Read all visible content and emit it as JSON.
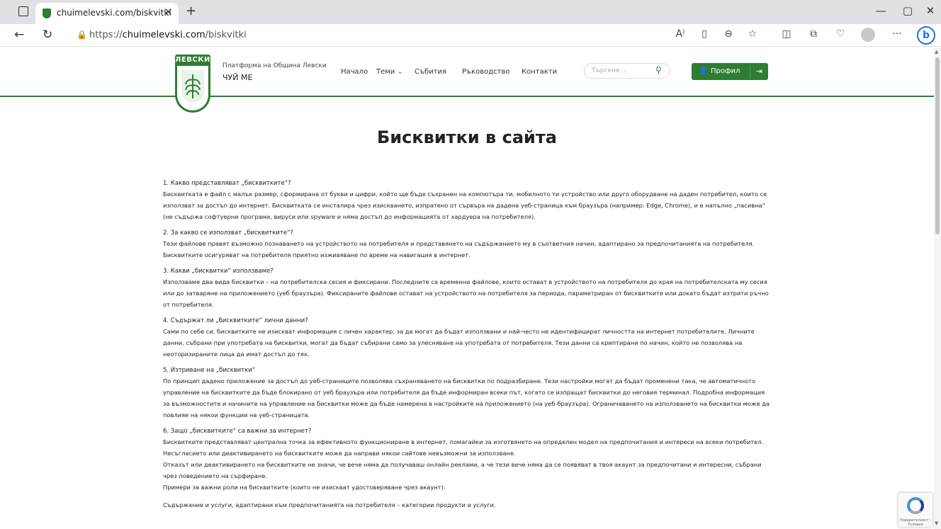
{
  "browser": {
    "tab_title": "chuimelevski.com/biskvitki",
    "tab_close": "×",
    "new_tab": "+",
    "url_prefix": "https://",
    "url_domain": "chuimelevski.com",
    "url_path": "/biskvitki",
    "window_controls": {
      "minimize": "—",
      "maximize": "▢",
      "close": "✕"
    },
    "nav": {
      "back": "←",
      "refresh": "↻"
    },
    "toolbar_icons": [
      "read-aloud-icon",
      "immersive-reader-icon",
      "zoom-icon",
      "favorite-icon",
      "split-screen-icon",
      "collections-icon",
      "browser-essentials-icon",
      "profile-icon",
      "more-icon",
      "bing-copilot-icon"
    ],
    "toolbar_glyphs": {
      "read_aloud": "A⁾",
      "reader": "▯",
      "zoom": "⊖",
      "favorite": "☆",
      "split": "◫",
      "collections": "⧉",
      "essentials": "♡",
      "more": "···",
      "bing": "b"
    }
  },
  "site": {
    "logo_text": "ЛЕВСКИ",
    "brand_sub": "Платформа на Община Левски",
    "brand_title": "ЧУЙ МЕ",
    "nav": {
      "home": "Начало",
      "topics": "Теми",
      "events": "Събития",
      "guide": "Ръководство",
      "contacts": "Контакти"
    },
    "search_placeholder": "Търсене...",
    "search_icon_glyph": "⚲",
    "profile_label": "Профил",
    "profile_glyph": "👤",
    "logout_glyph": "⇥",
    "accent_color": "#2e7d32"
  },
  "page": {
    "title": "Бисквитки в сайта",
    "sections": [
      {
        "heading": "1. Какво представляват „бисквитките“?",
        "body": "Бисквитката е файл с малък размер, сформирана от букви и цифри, който ще бъде съхранен на компютъра ти, мобилното ти устройство или друго оборудване на даден потребител, които се използват за достъп до интернет. Бисквитката се инсталира чрез изискването, изпратено от сървъра на дадена уеб-страница към браузъра (например: Edge, Chrome), и е напълно „пасивна“ (не съдържа софтуерни програми, вируси или spyware и няма достъп до информацията от хардуера на потребителя)."
      },
      {
        "heading": "2. За какво се използват „бисквитките“?",
        "body": "Тези файлове правят възможно познаването на устройството на потребителя и представянето на съдържанието му в съответния начин, адаптирано за предпочитанията на потребителя. Бисквитките осигуряват на потребителя приятно изживяване по време на навигация в интернет."
      },
      {
        "heading": "3. Какви „бисквитки“ използваме?",
        "body": "Използваме два вида бисквитки – на потребителска сесия и фиксирани. Последните са временни файлове, които остават в устройството на потребителя до края на потребителската му сесия или до затваряне на приложението (уеб браузъра). Фиксираните файлове остават на устройството на потребителя за периода, параметриран от бисквитките или докато бъдат изтрити ръчно от потребителя."
      },
      {
        "heading": "4. Съдържат ли „бисквитките“ лични данни?",
        "body": "Сами по себе си, бисквитките не изискват информация с личен характер, за да могат да бъдат използвани и най-често не идентифицират личността на интернет потребителите. Личните данни, събрани при употребата на бисквитки, могат да бъдат събирани само за улесняване на употребата от потребителя. Тези данни са криптирани по начин, който не позволява на неоторизираните лица да имат достъп до тях."
      },
      {
        "heading": "5. Изтриване на „бисквитки“",
        "body": "По принцип дадено приложение за достъп до уеб-страниците позволява съхраняването на бисквитки по подразбиране. Тези настройки могат да бъдат променени така, че автоматичното управление на бисквитките да бъде блокирано от уеб браузъра или потребителя да бъде информиран всеки път, когато се изпращат бисквитки до неговия терминал. Подробна информация за възможностите и начините на управление на бисквитки може да бъде намерена в настройките на приложението (на уеб-браузъра). Ограничаването на използването на бисквитки може да повлияе на някои функции на уеб-страницата."
      },
      {
        "heading": "6. Защо „бисквитките“ са важни за интернет?",
        "body": "Бисквитките представляват централна точка за ефективното функциониране в интернет, помагайки за изготвянето на определен модел на предпочитания и интереси на всеки потребител. Несъгласието или деактивирането на бисквитките може да направи някои сайтове невъзможни за използване.",
        "body2": "Отказът или деактивирането на бисквитките не значи, че вече няма да получаваш онлайн реклами, а че тези вече няма да се появяват в твоя акаунт за предпочитани и интересни, събрани чрез поведението на сърфиране.",
        "body3": "Примери за важни роли на бисквитките (които не изискват удостоверяване чрез акаунт):"
      }
    ],
    "cut_line": "Съдържание и услуги, адаптирани към предпочитанията на потребителя – категории продукти и услуги."
  },
  "recaptcha": {
    "text": "Поверителност - Условия"
  }
}
